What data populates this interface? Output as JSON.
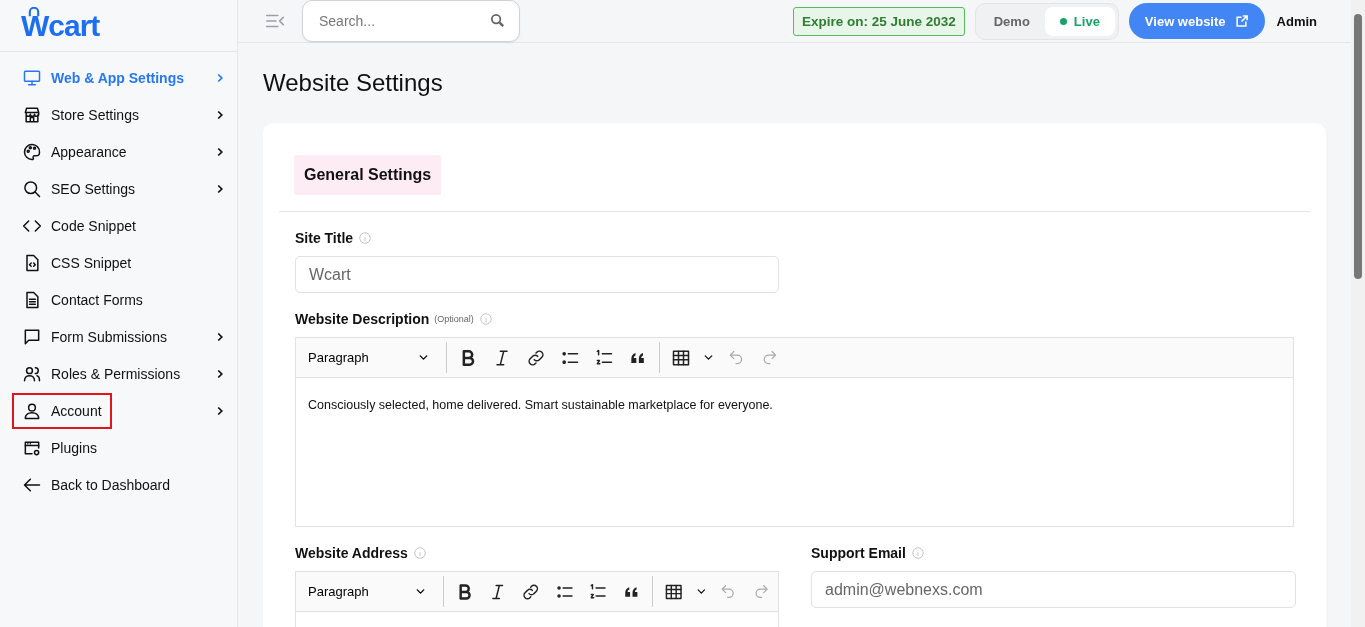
{
  "logo": {
    "text": "Wcart"
  },
  "sidebar": {
    "items": [
      {
        "label": "Web & App Settings",
        "has_arrow": true,
        "selected": true,
        "outlined": false
      },
      {
        "label": "Store Settings",
        "has_arrow": true,
        "selected": false,
        "outlined": false
      },
      {
        "label": "Appearance",
        "has_arrow": true,
        "selected": false,
        "outlined": false
      },
      {
        "label": "SEO Settings",
        "has_arrow": true,
        "selected": false,
        "outlined": false
      },
      {
        "label": "Code Snippet",
        "has_arrow": false,
        "selected": false,
        "outlined": false
      },
      {
        "label": "CSS Snippet",
        "has_arrow": false,
        "selected": false,
        "outlined": false
      },
      {
        "label": "Contact Forms",
        "has_arrow": false,
        "selected": false,
        "outlined": false
      },
      {
        "label": "Form Submissions",
        "has_arrow": true,
        "selected": false,
        "outlined": false
      },
      {
        "label": "Roles & Permissions",
        "has_arrow": true,
        "selected": false,
        "outlined": false
      },
      {
        "label": "Account",
        "has_arrow": true,
        "selected": false,
        "outlined": true
      },
      {
        "label": "Plugins",
        "has_arrow": false,
        "selected": false,
        "outlined": false
      },
      {
        "label": "Back to Dashboard",
        "has_arrow": false,
        "selected": false,
        "outlined": false
      }
    ]
  },
  "topbar": {
    "search": {
      "placeholder": "Search..."
    },
    "expiry": "Expire on: 25 June 2032",
    "mode_toggle": [
      {
        "label": "Demo",
        "selected": false
      },
      {
        "label": "Live",
        "selected": true
      }
    ],
    "view_button": "View website",
    "user": "Admin"
  },
  "page_title": "Website Settings",
  "card": {
    "section_title": "General Settings",
    "site_title": {
      "label": "Site Title",
      "value": "Wcart"
    },
    "description": {
      "label": "Website Description",
      "note": "(Optional)",
      "format": "Paragraph",
      "content": "Consciously selected, home delivered. Smart sustainable marketplace for everyone."
    },
    "address": {
      "label": "Website Address",
      "format": "Paragraph"
    },
    "support_email": {
      "label": "Support Email",
      "value": "admin@webnexs.com"
    }
  }
}
